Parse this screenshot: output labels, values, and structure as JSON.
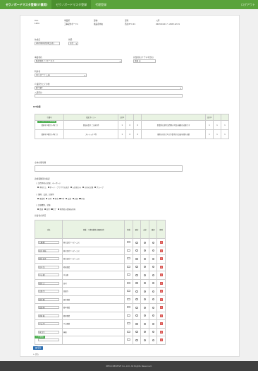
{
  "app": {
    "title": "ゼクノボードマスタ登録(介護用)",
    "nav": [
      "ゼクノボードマスタ登録",
      "代理登録"
    ],
    "user": "ログアウト"
  },
  "header": {
    "col_labels": [
      "FNo.",
      "事業所",
      "建物",
      "部屋",
      "入所"
    ],
    "col_values": [
      "1234",
      "工事受付ボード1",
      "施設名中央",
      "西北3F 1 01",
      "2023.04.01 ～ 2023.12.31"
    ]
  },
  "form": {
    "date_label": "作成日",
    "date_value": "2023年09月06日(木)",
    "status_label": "状態",
    "status_value": "待ち",
    "org_label": "事業者名",
    "org_value": "株式会社アイビーエス",
    "contact_label": "担当者名(ケアマネ氏名)",
    "contact_value": "佐藤 花",
    "user_label": "利用者",
    "user_value": "101 ボード 工事",
    "care_label": "介護区分とその他",
    "care_value1": "要介護3",
    "care_value2": "入居区分"
  },
  "ict_section": {
    "title": "ICT比較",
    "add_button": "＋ コメント行を追加",
    "head_left": [
      "行番号",
      "指定ポイント"
    ],
    "head_groups": [
      "日付1",
      "日付2"
    ],
    "rows": [
      {
        "no": "選択可(1番から5まで)",
        "point": "参加を促す ご自宅1件",
        "a": "1",
        "b": "0",
        "c": "0",
        "note": "事業所の説明 訪問時の写真の撮影が必要です",
        "d": "1",
        "e": "1",
        "f": "1"
      },
      {
        "no": "選択可(1番から5まで)",
        "point": "ストレッチ 2件",
        "a": "1",
        "b": "0",
        "c": "0",
        "note": "個別の対応で1日 作業不足の記録を残す必要",
        "d": "1",
        "e": "1",
        "f": "1"
      }
    ]
  },
  "remarks": {
    "label": "全体の備考欄",
    "value": ""
  },
  "options": {
    "label": "診療報酬等の確認",
    "groups": [
      {
        "title": "○ 訪問予約の記録、キーボード",
        "items": [
          "予約なし",
          "ボード・ブラウザの表示",
          "入居者のみ",
          "以前の記録",
          "グループ"
        ]
      },
      {
        "title": "○ 慣例、会議、記録等",
        "items": [
          "事業所",
          "日付",
          "担当",
          "1件",
          "会議",
          "記録",
          "内容"
        ]
      },
      {
        "title": "○ 記録種別、状態",
        "items": [
          "登録",
          "日付",
          "完了",
          "利用者の情報を共有"
        ]
      }
    ]
  },
  "staff": {
    "label": "担当者の状況",
    "head": [
      "氏名",
      "事業・介護事業所の概要名称",
      "状態",
      "確定",
      "未定",
      "確認",
      "削除"
    ],
    "rows": [
      {
        "name": "大橋 健",
        "company": "株式会社アイビーエス"
      },
      {
        "name": "松井 和枝",
        "company": "株式会社アイビーエス"
      },
      {
        "name": "藤井 直子",
        "company": "株式会社アイビーエス"
      },
      {
        "name": "田中 浩",
        "company": "地域事業"
      },
      {
        "name": "中山 徹",
        "company": "中山雅"
      },
      {
        "name": "藤井 大",
        "company": "西村"
      },
      {
        "name": "宮野 学",
        "company": "西園寺"
      },
      {
        "name": "藤本 隆",
        "company": "福永事業"
      },
      {
        "name": "富田 泰",
        "company": "藤本事業"
      },
      {
        "name": "藤原 楓",
        "company": "藤原事業"
      },
      {
        "name": "平山 学",
        "company": "平山事業"
      },
      {
        "name": "林 浩平",
        "company": "林雅"
      },
      {
        "name": "",
        "company": ""
      }
    ],
    "add_button": "＋ 行追加"
  },
  "actions": {
    "save": "保存",
    "back": "戻る"
  },
  "footer": {
    "text": "ZEN-CREATIVE Co.,Ltd. All Rights Reserved."
  }
}
